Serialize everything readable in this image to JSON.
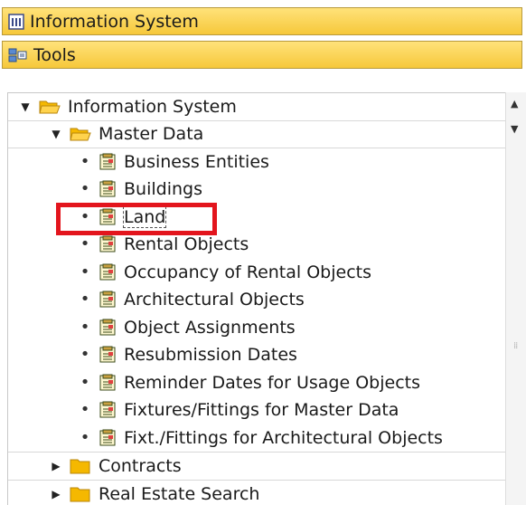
{
  "toolbar_top": {
    "title": "Information System",
    "icon": "info-system-icon"
  },
  "toolbar_tools": {
    "title": "Tools",
    "icon": "tools-icon"
  },
  "tree": {
    "root": {
      "label": "Information System",
      "expanded": true
    },
    "master": {
      "label": "Master Data",
      "expanded": true
    },
    "items": [
      "Business Entities",
      "Buildings",
      "Land",
      "Rental Objects",
      "Occupancy of Rental Objects",
      "Architectural Objects",
      "Object Assignments",
      "Resubmission Dates",
      "Reminder Dates for Usage Objects",
      "Fixtures/Fittings for Master Data",
      "Fixt./Fittings for Architectural Objects"
    ],
    "collapsed": [
      "Contracts",
      "Real Estate Search"
    ]
  },
  "colors": {
    "toolbar": "#f6c83a",
    "highlight": "#e3151d",
    "folder": "#f5b800"
  }
}
